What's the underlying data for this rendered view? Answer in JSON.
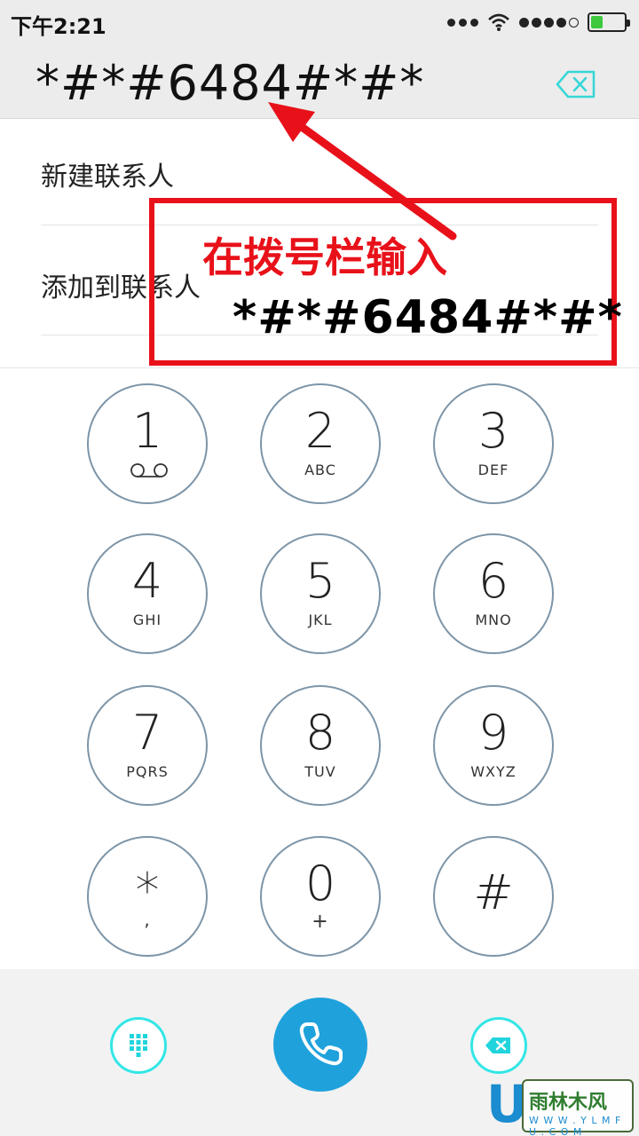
{
  "status_bar": {
    "time": "下午2:21",
    "battery_level": 0.35,
    "colors": {
      "battery": "#3ec93e"
    }
  },
  "dialer": {
    "number": "*#*#6484#*#*",
    "backspace_icon": "backspace-outline-icon"
  },
  "options": [
    {
      "label": "新建联系人"
    },
    {
      "label": "添加到联系人"
    }
  ],
  "annotation": {
    "title": "在拨号栏输入",
    "code": "*#*#6484#*#*",
    "color": "#e8111a"
  },
  "keypad": [
    {
      "digit": "1",
      "letters": ""
    },
    {
      "digit": "2",
      "letters": "ABC"
    },
    {
      "digit": "3",
      "letters": "DEF"
    },
    {
      "digit": "4",
      "letters": "GHI"
    },
    {
      "digit": "5",
      "letters": "JKL"
    },
    {
      "digit": "6",
      "letters": "MNO"
    },
    {
      "digit": "7",
      "letters": "PQRS"
    },
    {
      "digit": "8",
      "letters": "TUV"
    },
    {
      "digit": "9",
      "letters": "WXYZ"
    },
    {
      "digit": "*",
      "letters": ","
    },
    {
      "digit": "0",
      "letters": "+"
    },
    {
      "digit": "#",
      "letters": ""
    }
  ],
  "bottom_bar": {
    "keypad_icon": "dialpad-icon",
    "call_icon": "phone-icon",
    "delete_icon": "backspace-icon",
    "call_color": "#1fa2dc",
    "accent_color": "#33e6e6"
  },
  "watermark": {
    "letter": "U",
    "text": "雨林木风",
    "url": "W W W . Y L M F U . C O M"
  }
}
